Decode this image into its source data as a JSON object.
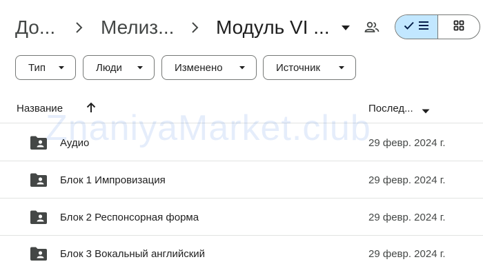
{
  "breadcrumb": {
    "items": [
      {
        "label": "До..."
      },
      {
        "label": "Мелиз..."
      },
      {
        "label": "Модуль VI ..."
      }
    ]
  },
  "icons": {
    "separator": "chevron-right-icon",
    "caret": "arrow-drop-down-icon",
    "share": "people-icon",
    "list_view": "list-view-icon",
    "grid_view": "grid-view-icon",
    "folder": "shared-folder-icon",
    "sort": "arrow-upward-icon"
  },
  "view_toggle": {
    "active": "list",
    "active_color": "#c2e7ff"
  },
  "filters": [
    {
      "label": "Тип"
    },
    {
      "label": "Люди"
    },
    {
      "label": "Изменено"
    },
    {
      "label": "Источник"
    }
  ],
  "table": {
    "columns": {
      "name": "Название",
      "modified": "Послед..."
    },
    "rows": [
      {
        "name": "Аудио",
        "modified": "29 февр. 2024 г."
      },
      {
        "name": "Блок 1 Импровизация",
        "modified": "29 февр. 2024 г."
      },
      {
        "name": "Блок 2 Респонсорная форма",
        "modified": "29 февр. 2024 г."
      },
      {
        "name": "Блок 3 Вокальный английский",
        "modified": "29 февр. 2024 г."
      }
    ]
  },
  "watermark": {
    "text": "ZnaniyaMarket.club"
  }
}
